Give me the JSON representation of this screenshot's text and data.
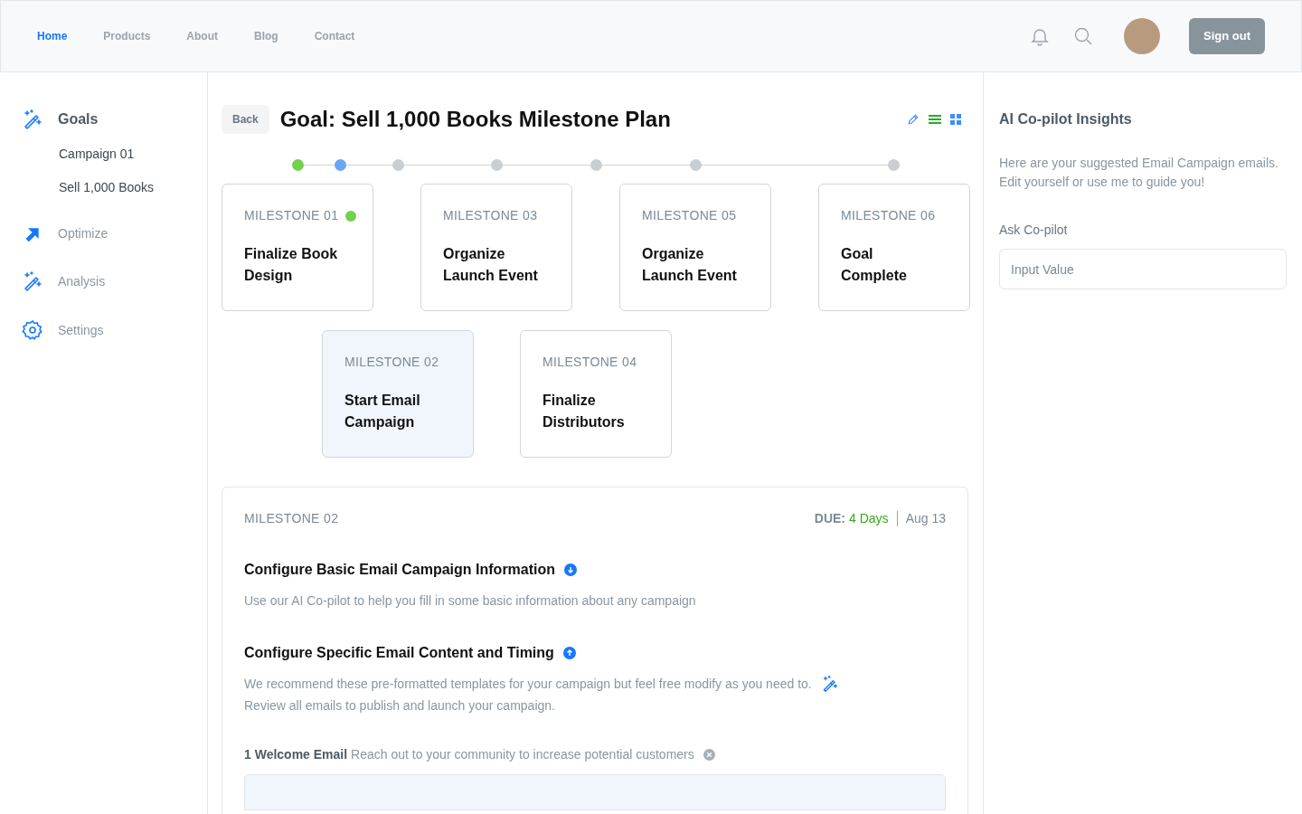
{
  "nav": {
    "links": [
      {
        "label": "Home",
        "selected": true
      },
      {
        "label": "Products",
        "selected": false
      },
      {
        "label": "About",
        "selected": false
      },
      {
        "label": "Blog",
        "selected": false
      },
      {
        "label": "Contact",
        "selected": false
      }
    ],
    "sign_out": "Sign out"
  },
  "sidebar": {
    "items": [
      {
        "label": "Goals",
        "kind": "wand",
        "expanded": true,
        "children": [
          {
            "label": "Campaign 01"
          },
          {
            "label": "Sell 1,000 Books"
          }
        ]
      },
      {
        "label": "Optimize",
        "kind": "arrow",
        "expanded": false
      },
      {
        "label": "Analysis",
        "kind": "wand",
        "expanded": false
      },
      {
        "label": "Settings",
        "kind": "gear",
        "expanded": false
      }
    ]
  },
  "main": {
    "back": "Back",
    "title": "Goal: Sell 1,000 Books Milestone Plan",
    "timeline": [
      {
        "kind": "done"
      },
      {
        "kind": "current"
      },
      {
        "kind": "pending"
      },
      {
        "kind": "pending"
      },
      {
        "kind": "pending"
      },
      {
        "kind": "pending"
      },
      {
        "kind": "pending"
      }
    ],
    "milestones_top": [
      {
        "label": "MILESTONE 01",
        "title": "Finalize Book Design",
        "done": true,
        "selected": false
      },
      {
        "label": "MILESTONE 03",
        "title": "Organize Launch Event",
        "done": false,
        "selected": false
      },
      {
        "label": "MILESTONE 05",
        "title": "Organize Launch Event",
        "done": false,
        "selected": false
      },
      {
        "label": "MILESTONE 06",
        "title": "Goal Complete",
        "done": false,
        "selected": false
      }
    ],
    "milestones_bottom": [
      {
        "label": "MILESTONE 02",
        "title": "Start Email Campaign",
        "done": false,
        "selected": true
      },
      {
        "label": "MILESTONE 04",
        "title": "Finalize Distributors",
        "done": false,
        "selected": false
      }
    ],
    "detail": {
      "label": "MILESTONE 02",
      "due_label": "DUE:",
      "due_value": "4 Days",
      "date": "Aug 13",
      "sections": [
        {
          "title": "Configure Basic Email Campaign Information",
          "expanded": false,
          "text": "Use our AI Co-pilot to help you fill in some basic information about any campaign",
          "wand": false
        },
        {
          "title": "Configure Specific Email Content and Timing",
          "expanded": true,
          "text": "We recommend these pre-formatted templates for your campaign but feel free modify as you need to.",
          "text2": "Review all emails to publish and launch your campaign.",
          "wand": true
        }
      ],
      "emails": [
        {
          "name": "1 Welcome Email",
          "description": "Reach out to your community to increase potential customers"
        }
      ]
    }
  },
  "copilot": {
    "title": "AI Co-pilot Insights",
    "text": "Here are your suggested Email Campaign emails. Edit yourself or use me to guide you!",
    "ask_label": "Ask Co-pilot",
    "placeholder": "Input Value"
  }
}
